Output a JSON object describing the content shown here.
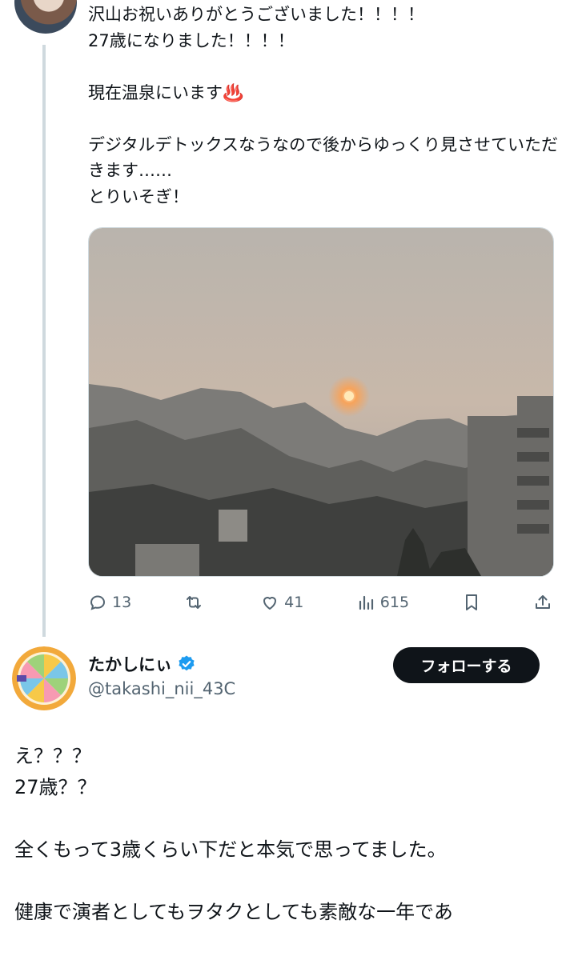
{
  "original_tweet": {
    "text": "沢山お祝いありがとうございました！！！！\n27歳になりました！！！！\n\n現在温泉にいます♨️\n\nデジタルデトックスなうなので後からゆっくり見させていただきます……\nとりいそぎ！",
    "metrics": {
      "replies": "13",
      "retweets": "",
      "likes": "41",
      "views": "615"
    }
  },
  "reply": {
    "display_name": "たかしにぃ",
    "handle": "@takashi_nii_43C",
    "follow_label": "フォローする",
    "text": "え？？？\n27歳？？\n\n全くもって3歳くらい下だと本気で思ってました。\n\n健康で演者としてもヲタクとしても素敵な一年であ"
  },
  "colors": {
    "verified": "#1d9bf0",
    "icon_gray": "#536471",
    "follow_bg": "#0f1419"
  },
  "icons": [
    "reply-icon",
    "retweet-icon",
    "like-icon",
    "views-icon",
    "bookmark-icon",
    "share-icon",
    "verified-badge-icon"
  ]
}
